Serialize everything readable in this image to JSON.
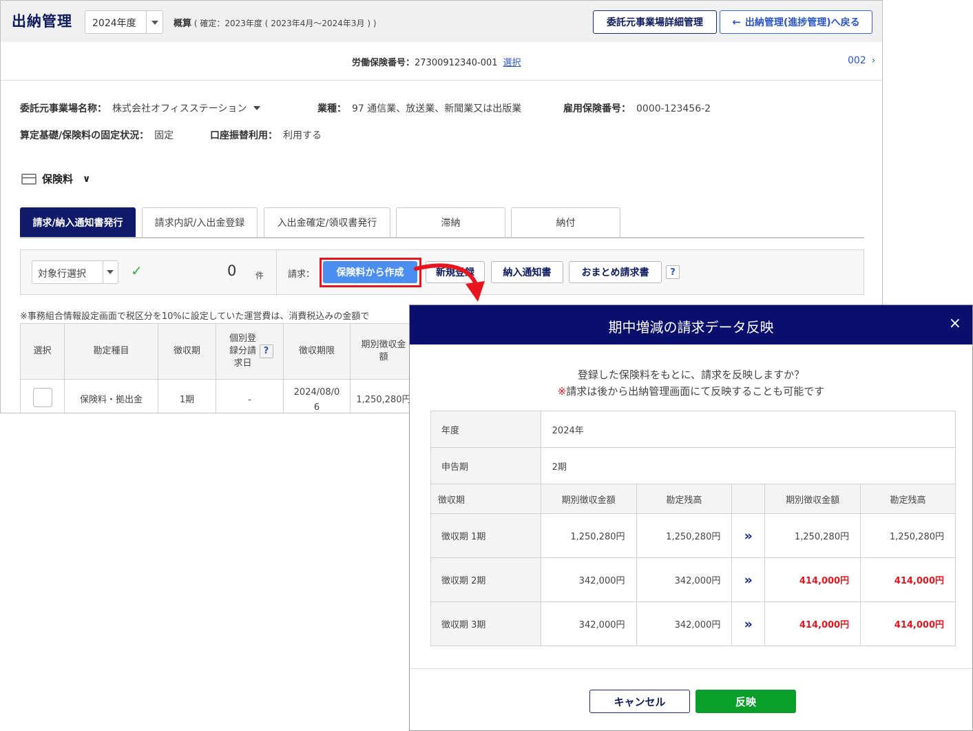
{
  "app": {
    "title": "出納管理",
    "year_select": "2024年度",
    "summary_label": "概算",
    "summary_detail": "( 確定：2023年度 ( 2023年4月～2024年3月 ) )",
    "detail_button": "委託元事業場詳細管理",
    "back_button": "出納管理(進捗管理)へ戻る"
  },
  "insurance_no": {
    "label": "労働保険番号：",
    "value": "27300912340-001",
    "select_link": "選択",
    "next": "002"
  },
  "info": {
    "client_label": "委託元事業場名称：",
    "client_value": "株式会社オフィスステーション",
    "industry_label": "業種：",
    "industry_value": "97 通信業、放送業、新聞業又は出版業",
    "empno_label": "雇用保険番号：",
    "empno_value": "0000-123456-2",
    "fixed_label": "算定基礎/保険料の固定状況：",
    "fixed_value": "固定",
    "transfer_label": "口座振替利用：",
    "transfer_value": "利用する"
  },
  "section": {
    "title": "保険料"
  },
  "tabs": [
    {
      "label": "請求/納入通知書発行",
      "active": true
    },
    {
      "label": "請求内訳/入出金登録",
      "active": false
    },
    {
      "label": "入出金確定/領収書発行",
      "active": false
    },
    {
      "label": "滞納",
      "active": false
    },
    {
      "label": "納付",
      "active": false
    }
  ],
  "toolbar": {
    "row_select": "対象行選択",
    "count": "0",
    "count_unit": "件",
    "bill_label": "請求：",
    "create_button": "保険料から作成",
    "new_button": "新規登録",
    "notice_button": "納入通知書",
    "bundle_button": "おまとめ請求書",
    "help": "?"
  },
  "note": "※事務組合情報設定画面で税区分を10%に設定していた運営費は、消費税込みの金額で",
  "bg_table": {
    "headers": [
      "選択",
      "勘定種目",
      "徴収期",
      "個別登録分請求日",
      "徴収期限",
      "期別徴収金額"
    ],
    "row": {
      "item": "保険料・拠出金",
      "period": "1期",
      "date": "-",
      "deadline": "2024/08/06",
      "amount": "1,250,280円"
    }
  },
  "modal": {
    "title": "期中増減の請求データ反映",
    "close": "×",
    "message1": "登録した保険料をもとに、請求を反映しますか？",
    "message2_mark": "※",
    "message2": "請求は後から出納管理画面にて反映することも可能です",
    "year_label": "年度",
    "year_value": "2024年",
    "report_label": "申告期",
    "report_value": "2期",
    "headers": [
      "徴収期",
      "期別徴収金額",
      "勘定残高",
      "",
      "期別徴収金額",
      "勘定残高"
    ],
    "rows": [
      {
        "period": "徴収期 1期",
        "old_amount": "1,250,280円",
        "old_balance": "1,250,280円",
        "new_amount": "1,250,280円",
        "new_balance": "1,250,280円",
        "changed": false
      },
      {
        "period": "徴収期 2期",
        "old_amount": "342,000円",
        "old_balance": "342,000円",
        "new_amount": "414,000円",
        "new_balance": "414,000円",
        "changed": true
      },
      {
        "period": "徴収期 3期",
        "old_amount": "342,000円",
        "old_balance": "342,000円",
        "new_amount": "414,000円",
        "new_balance": "414,000円",
        "changed": true
      }
    ],
    "cancel_button": "キャンセル",
    "apply_button": "反映"
  },
  "colors": {
    "navy": "#0a0f6e",
    "accent_blue": "#4a8ef0",
    "highlight_red": "#e8141e",
    "apply_green": "#0a9e2a"
  }
}
